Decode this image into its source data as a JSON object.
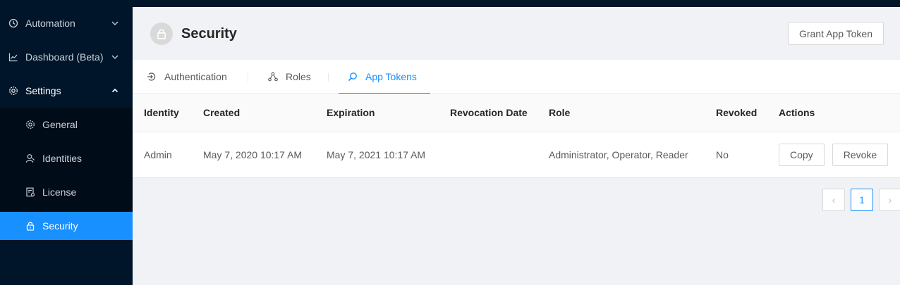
{
  "sidebar": {
    "items": [
      {
        "label": "Automation",
        "icon": "automation-icon",
        "expanded": false
      },
      {
        "label": "Dashboard (Beta)",
        "icon": "chart-line-icon",
        "expanded": false
      },
      {
        "label": "Settings",
        "icon": "gear-icon",
        "expanded": true
      },
      {
        "label": "General",
        "icon": "gear-icon"
      },
      {
        "label": "Identities",
        "icon": "user-icon"
      },
      {
        "label": "License",
        "icon": "license-icon"
      },
      {
        "label": "Security",
        "icon": "lock-icon",
        "selected": true
      }
    ]
  },
  "header": {
    "title": "Security",
    "icon": "lock-icon",
    "grant_button": "Grant App Token"
  },
  "tabs": [
    {
      "label": "Authentication",
      "icon": "login-icon"
    },
    {
      "label": "Roles",
      "icon": "roles-icon"
    },
    {
      "label": "App Tokens",
      "icon": "search-icon",
      "active": true
    }
  ],
  "table": {
    "columns": [
      "Identity",
      "Created",
      "Expiration",
      "Revocation Date",
      "Role",
      "Revoked",
      "Actions"
    ],
    "rows": [
      {
        "identity": "Admin",
        "created": "May 7, 2020 10:17 AM",
        "expiration": "May 7, 2021 10:17 AM",
        "revocation_date": "",
        "role": "Administrator, Operator, Reader",
        "revoked": "No",
        "actions": [
          "Copy",
          "Revoke"
        ]
      }
    ]
  },
  "pagination": {
    "current_page": "1",
    "prev_glyph": "‹",
    "next_glyph": "›"
  },
  "colors": {
    "sidebar_bg": "#001529",
    "accent": "#1890ff",
    "content_bg": "#f0f2f5"
  }
}
